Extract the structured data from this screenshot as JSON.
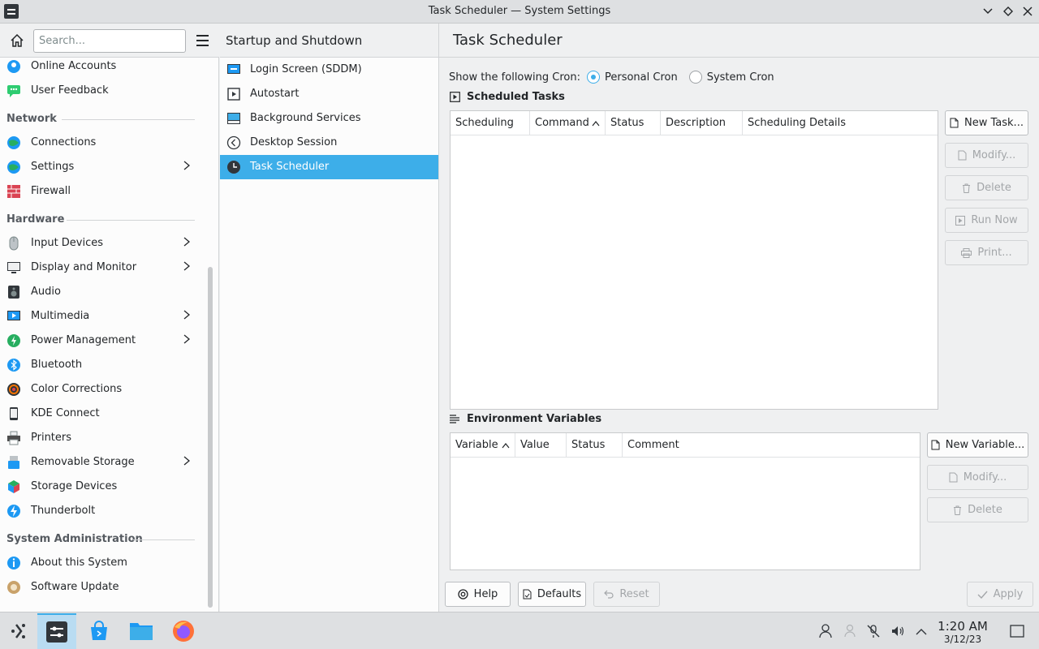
{
  "window": {
    "title": "Task Scheduler — System Settings"
  },
  "sidebar": {
    "search_placeholder": "Search...",
    "items": [
      {
        "label": "Online Accounts",
        "icon": "online-accounts-icon"
      },
      {
        "label": "User Feedback",
        "icon": "user-feedback-icon"
      },
      {
        "label": "Connections",
        "icon": "connections-icon"
      },
      {
        "label": "Settings",
        "icon": "network-settings-icon"
      },
      {
        "label": "Firewall",
        "icon": "firewall-icon"
      },
      {
        "label": "Input Devices",
        "icon": "mouse-icon"
      },
      {
        "label": "Display and Monitor",
        "icon": "display-icon"
      },
      {
        "label": "Audio",
        "icon": "speaker-icon"
      },
      {
        "label": "Multimedia",
        "icon": "multimedia-icon"
      },
      {
        "label": "Power Management",
        "icon": "power-icon"
      },
      {
        "label": "Bluetooth",
        "icon": "bluetooth-icon"
      },
      {
        "label": "Color Corrections",
        "icon": "color-icon"
      },
      {
        "label": "KDE Connect",
        "icon": "phone-icon"
      },
      {
        "label": "Printers",
        "icon": "printer-icon"
      },
      {
        "label": "Removable Storage",
        "icon": "usb-icon"
      },
      {
        "label": "Storage Devices",
        "icon": "storage-icon"
      },
      {
        "label": "Thunderbolt",
        "icon": "thunderbolt-icon"
      },
      {
        "label": "About this System",
        "icon": "info-icon"
      },
      {
        "label": "Software Update",
        "icon": "update-icon"
      }
    ],
    "sections": {
      "network": "Network",
      "hardware": "Hardware",
      "sysadmin": "System Administration"
    }
  },
  "middle": {
    "title": "Startup and Shutdown",
    "items": [
      {
        "label": "Login Screen (SDDM)"
      },
      {
        "label": "Autostart"
      },
      {
        "label": "Background Services"
      },
      {
        "label": "Desktop Session"
      },
      {
        "label": "Task Scheduler"
      }
    ]
  },
  "main": {
    "title": "Task Scheduler",
    "cron_label": "Show the following Cron:",
    "personal_cron": "Personal Cron",
    "system_cron": "System Cron",
    "scheduled_tasks": {
      "title": "Scheduled Tasks",
      "columns": [
        "Scheduling",
        "Command",
        "Status",
        "Description",
        "Scheduling Details"
      ],
      "buttons": {
        "new": "New Task...",
        "modify": "Modify...",
        "delete": "Delete",
        "run_now": "Run Now",
        "print": "Print..."
      }
    },
    "env_vars": {
      "title": "Environment Variables",
      "columns": [
        "Variable",
        "Value",
        "Status",
        "Comment"
      ],
      "buttons": {
        "new": "New Variable...",
        "modify": "Modify...",
        "delete": "Delete"
      }
    },
    "footer": {
      "help": "Help",
      "defaults": "Defaults",
      "reset": "Reset",
      "apply": "Apply"
    }
  },
  "taskbar": {
    "time": "1:20 AM",
    "date": "3/12/23"
  },
  "colors": {
    "accent": "#3daee9",
    "selected_text": "#ffffff"
  }
}
